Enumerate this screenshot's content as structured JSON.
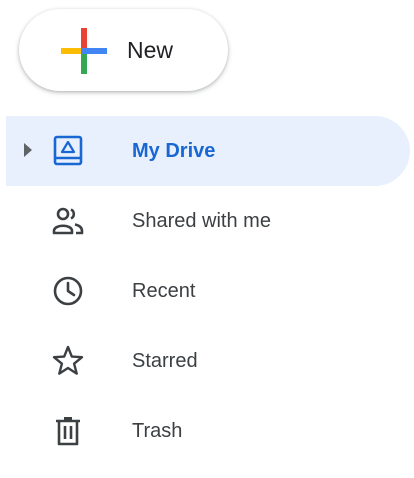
{
  "new_button": {
    "label": "New",
    "icon": "plus-multicolor-icon",
    "colors": {
      "blue": "#4285f4",
      "red": "#ea4335",
      "yellow": "#fbbc04",
      "green": "#34a853"
    }
  },
  "nav": {
    "items": [
      {
        "label": "My Drive",
        "icon": "drive-folder-icon",
        "active": true,
        "expandable": true
      },
      {
        "label": "Shared with me",
        "icon": "people-icon",
        "active": false
      },
      {
        "label": "Recent",
        "icon": "clock-icon",
        "active": false
      },
      {
        "label": "Starred",
        "icon": "star-icon",
        "active": false
      },
      {
        "label": "Trash",
        "icon": "trash-icon",
        "active": false
      }
    ]
  },
  "colors": {
    "active_bg": "#e8f0fe",
    "active_text": "#1967d2",
    "text": "#3c4043",
    "icon": "#5f6368"
  }
}
